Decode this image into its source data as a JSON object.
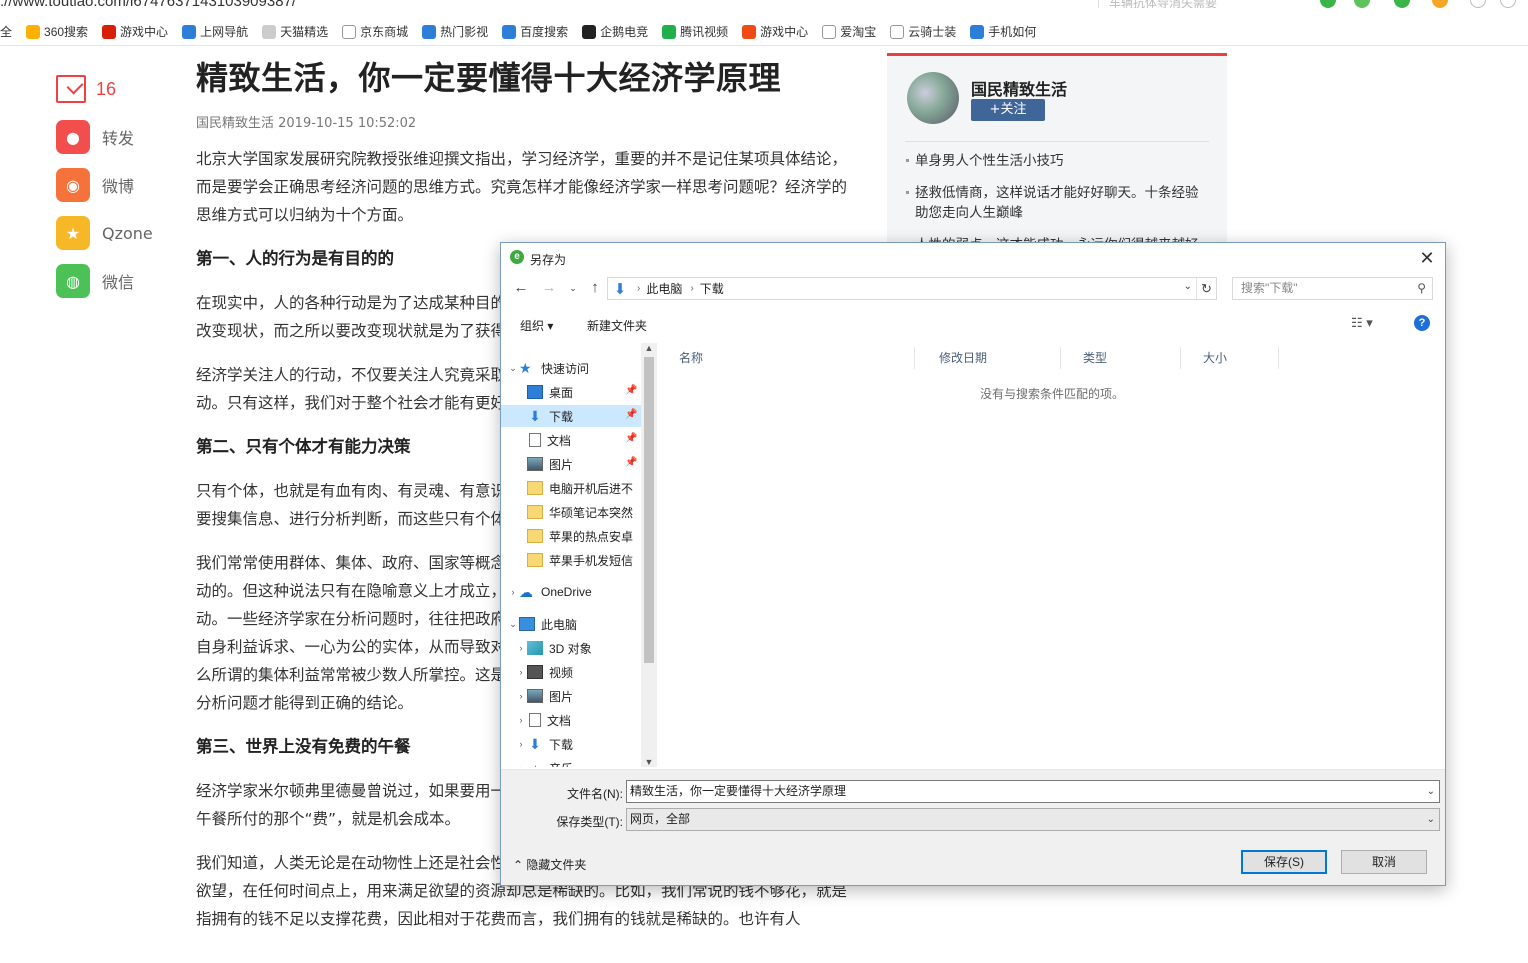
{
  "browser": {
    "url": "://www.toutiao.com/i6747637143103909387/",
    "search_placeholder": "车辆抗体导消失需要",
    "bookmarks": [
      {
        "label": "全",
        "icon": "apps-icon",
        "color": "#ffffff"
      },
      {
        "label": "360搜索",
        "icon": "360-icon",
        "color": "#ffb000"
      },
      {
        "label": "游戏中心",
        "icon": "game-icon",
        "color": "#d81e06"
      },
      {
        "label": "上网导航",
        "icon": "ie-icon",
        "color": "#2c7ed6"
      },
      {
        "label": "天猫精选",
        "icon": "tmall-icon",
        "color": "#cccccc"
      },
      {
        "label": "京东商城",
        "icon": "page-icon",
        "color": "#ffffff"
      },
      {
        "label": "热门影视",
        "icon": "paw-icon",
        "color": "#2c7ed6"
      },
      {
        "label": "百度搜索",
        "icon": "paw-icon",
        "color": "#2c7ed6"
      },
      {
        "label": "企鹅电竞",
        "icon": "penguin-icon",
        "color": "#222222"
      },
      {
        "label": "腾讯视频",
        "icon": "play-icon",
        "color": "#20b04b"
      },
      {
        "label": "游戏中心",
        "icon": "game-icon",
        "color": "#f04a14"
      },
      {
        "label": "爱淘宝",
        "icon": "page-icon",
        "color": "#ffffff"
      },
      {
        "label": "云骑士装",
        "icon": "page-icon",
        "color": "#ffffff"
      },
      {
        "label": "手机如何",
        "icon": "paw-icon",
        "color": "#2c7ed6"
      }
    ]
  },
  "share": {
    "comment_count": "16",
    "items": [
      {
        "label": "转发",
        "icon": "forward-icon",
        "color": "#f24e4e",
        "glyph": "●"
      },
      {
        "label": "微博",
        "icon": "weibo-icon",
        "color": "#f5733b",
        "glyph": "◉"
      },
      {
        "label": "Qzone",
        "icon": "qzone-icon",
        "color": "#f7b827",
        "glyph": "★"
      },
      {
        "label": "微信",
        "icon": "wechat-icon",
        "color": "#4cc256",
        "glyph": "◍"
      }
    ]
  },
  "article": {
    "title": "精致生活，你一定要懂得十大经济学原理",
    "meta": "国民精致生活  2019-10-15 10:52:02",
    "intro": "北京大学国家发展研究院教授张维迎撰文指出，学习经济学，重要的并不是记住某项具体结论，而是要学会正确思考经济问题的思维方式。究竟怎样才能像经济学家一样思考问题呢？经济学的思维方式可以归纳为十个方面。",
    "h1": "第一、人的行为是有目的的",
    "p1": "在现实中，人的各种行动是为了达成某种目的，经济学认为人的行为是有目的的。人的行动就是改变现状，而之所以要改变现状就是为了获得比现在更好的状态，更好地满足自己的需求。",
    "p2": "经济学关注人的行动，不仅要关注人究竟采取了什么样的行动，更要关注人为什么采取这样的行动。只有这样，我们对于整个社会才能有更好的理解。",
    "h2": "第二、只有个体才有能力决策",
    "p3": "只有个体，也就是有血有肉、有灵魂、有意识的个人才具有决策能力。任何决策都必须思考，需要搜集信息、进行分析判断，而这些只有个体才能够做到。",
    "p4": "我们常常使用群体、集体、政府、国家等概念，仿佛这些集体也像个人一样是有目的的、是能行动的。但这种说法只有在隐喻意义上才成立，实际上是个人在行动，只有在集体里面的人才能行动。一些经济学家在分析问题时，往往把政府、国家等集体当作行为单位，并把它们想象为没有自身利益诉求、一心为公的实体，从而导致对很多现象的误解，例如为什么政府会有腐败，为什么所谓的集体利益常常被少数人所掌控。这是一种集体主义的分析角度，用方法论的个人主义来分析问题才能得到正确的结论。",
    "h3": "第三、世界上没有免费的午餐",
    "p5": "经济学家米尔顿弗里德曼曾说过，如果要用一句话概括经济学的全部内容，那就是在这里，要为午餐所付的那个“费”，就是机会成本。",
    "p6": "我们知道，人类无论是在动物性上还是社会性上，都有很多的欲望。但不幸的是，相对于人们的欲望，在任何时间点上，用来满足欲望的资源却总是稀缺的。比如，我们常说的钱不够花，就是指拥有的钱不足以支撑花费，因此相对于花费而言，我们拥有的钱就是稀缺的。也许有人"
  },
  "sidebar": {
    "author": "国民精致生活",
    "follow": "+关注",
    "related": [
      "单身男人个性生活小技巧",
      "拯救低情商，这样说话才能好好聊天。十条经验助您走向人生巅峰",
      "人性的弱点，这才能成功，永远你们得越来越好"
    ]
  },
  "dialog": {
    "title": "另存为",
    "close": "✕",
    "path": [
      "此电脑",
      "下载"
    ],
    "search_placeholder": "搜索\"下载\"",
    "organize": "组织 ▾",
    "new_folder": "新建文件夹",
    "tree": [
      {
        "label": "快速访问",
        "icon": "star-icon",
        "level": 0,
        "exp": "⌄",
        "pin": false
      },
      {
        "label": "桌面",
        "icon": "desktop-icon",
        "level": 1,
        "exp": "",
        "pin": true
      },
      {
        "label": "下载",
        "icon": "download-icon",
        "level": 1,
        "exp": "",
        "pin": true,
        "selected": true
      },
      {
        "label": "文档",
        "icon": "document-icon",
        "level": 1,
        "exp": "",
        "pin": true
      },
      {
        "label": "图片",
        "icon": "picture-icon",
        "level": 1,
        "exp": "",
        "pin": true
      },
      {
        "label": "电脑开机后进不",
        "icon": "folder-icon",
        "level": 1,
        "exp": "",
        "pin": false
      },
      {
        "label": "华硕笔记本突然",
        "icon": "folder-icon",
        "level": 1,
        "exp": "",
        "pin": false
      },
      {
        "label": "苹果的热点安卓",
        "icon": "folder-icon",
        "level": 1,
        "exp": "",
        "pin": false
      },
      {
        "label": "苹果手机发短信",
        "icon": "folder-icon",
        "level": 1,
        "exp": "",
        "pin": false
      },
      {
        "label": "OneDrive",
        "icon": "cloud-icon",
        "level": 0,
        "exp": "›",
        "pin": false
      },
      {
        "label": "此电脑",
        "icon": "computer-icon",
        "level": 0,
        "exp": "⌄",
        "pin": false
      },
      {
        "label": "3D 对象",
        "icon": "3d-objects-icon",
        "level": 1,
        "exp": "›",
        "pin": false
      },
      {
        "label": "视频",
        "icon": "video-icon",
        "level": 1,
        "exp": "›",
        "pin": false
      },
      {
        "label": "图片",
        "icon": "picture-icon",
        "level": 1,
        "exp": "›",
        "pin": false
      },
      {
        "label": "文档",
        "icon": "document-icon",
        "level": 1,
        "exp": "›",
        "pin": false
      },
      {
        "label": "下载",
        "icon": "download-icon",
        "level": 1,
        "exp": "›",
        "pin": false
      },
      {
        "label": "音乐",
        "icon": "music-icon",
        "level": 1,
        "exp": "›",
        "pin": false
      }
    ],
    "columns": [
      "名称",
      "修改日期",
      "类型",
      "大小"
    ],
    "empty_message": "没有与搜索条件匹配的项。",
    "filename_label": "文件名(N):",
    "filename_value": "精致生活，你一定要懂得十大经济学原理",
    "filetype_label": "保存类型(T):",
    "filetype_value": "网页，全部",
    "hide_folders": "隐藏文件夹",
    "save": "保存(S)",
    "cancel": "取消"
  }
}
